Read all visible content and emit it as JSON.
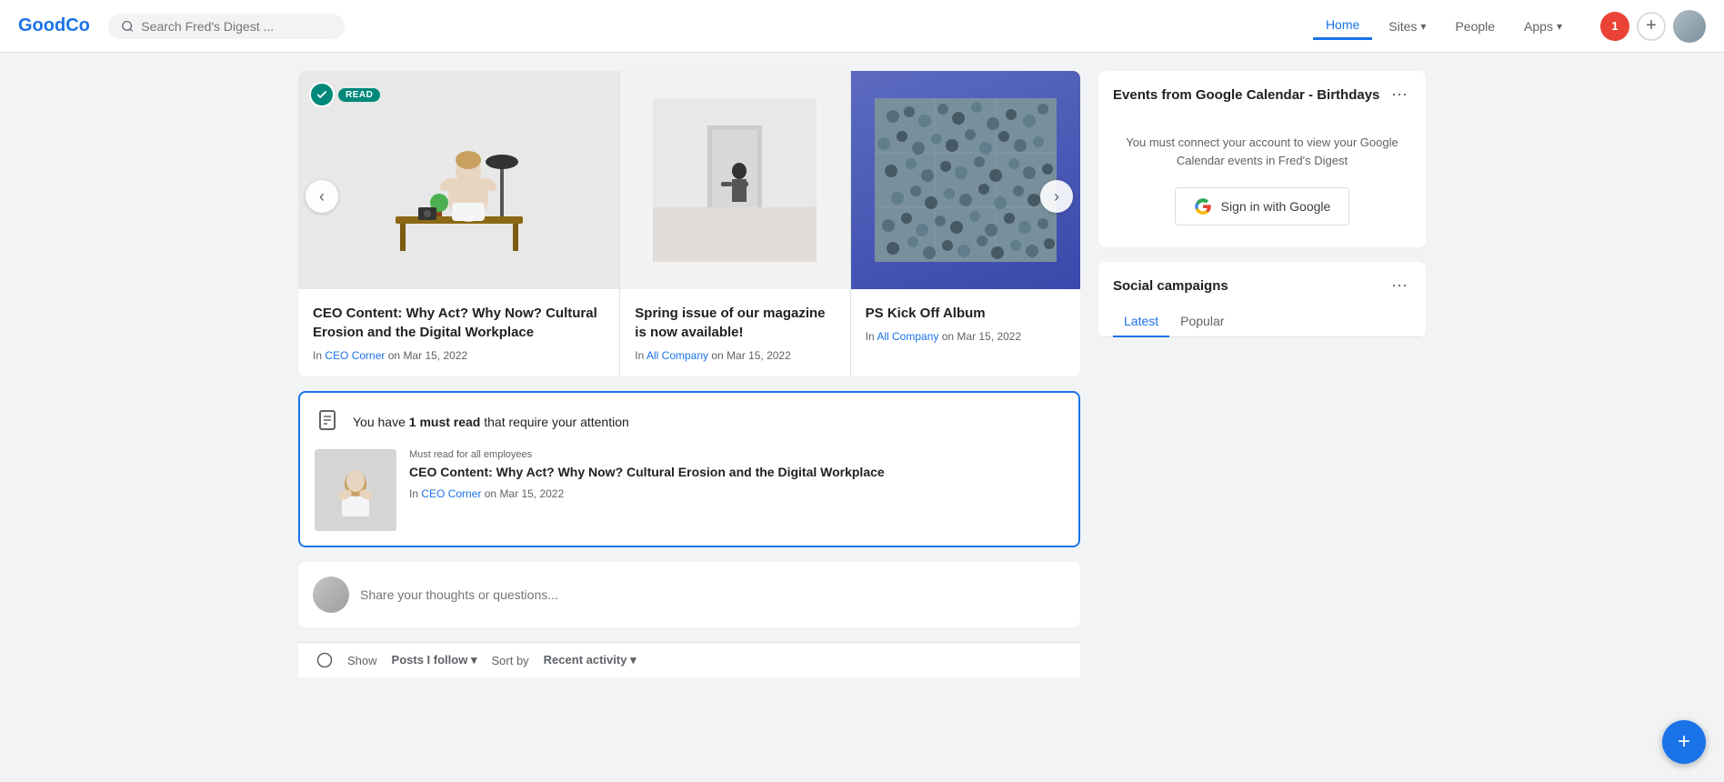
{
  "app": {
    "logo": "GoodCo"
  },
  "header": {
    "search_placeholder": "Search Fred's Digest ...",
    "nav": [
      {
        "id": "home",
        "label": "Home",
        "active": true
      },
      {
        "id": "sites",
        "label": "Sites",
        "dropdown": true
      },
      {
        "id": "people",
        "label": "People"
      },
      {
        "id": "apps",
        "label": "Apps",
        "dropdown": true
      }
    ],
    "notif_count": "1"
  },
  "carousel": {
    "prev_label": "‹",
    "next_label": "›",
    "read_badge": "READ",
    "slides": [
      {
        "id": "slide-1",
        "title": "CEO Content: Why Act? Why Now? Cultural Erosion and the Digital Workplace",
        "location": "CEO Corner",
        "date": "Mar 15, 2022",
        "preposition": "In",
        "conjunction": "on"
      },
      {
        "id": "slide-2",
        "title": "Spring issue of our magazine is now available!",
        "location": "All Company",
        "date": "Mar 15, 2022",
        "preposition": "In",
        "conjunction": "on"
      },
      {
        "id": "slide-3",
        "title": "PS Kick Off Album",
        "location": "All Company",
        "date": "Mar 15, 2022",
        "preposition": "In",
        "conjunction": "on"
      }
    ]
  },
  "must_read": {
    "prefix": "You have ",
    "count_text": "1 must read",
    "suffix": " that require your attention",
    "article": {
      "tag": "Must read for all employees",
      "title": "CEO Content: Why Act? Why Now? Cultural Erosion and the Digital Workplace",
      "location": "CEO Corner",
      "date": "Mar 15, 2022",
      "preposition": "In",
      "conjunction": "on"
    }
  },
  "thought_box": {
    "placeholder": "Share your thoughts or questions..."
  },
  "calendar_widget": {
    "title": "Events from Google Calendar - Birthdays",
    "body_text": "You must connect your account to view your Google Calendar events in Fred's Digest",
    "signin_label": "Sign in with Google"
  },
  "social_campaigns": {
    "title": "Social campaigns",
    "tabs": [
      {
        "id": "latest",
        "label": "Latest",
        "active": true
      },
      {
        "id": "popular",
        "label": "Popular"
      }
    ]
  },
  "bottom_bar": {
    "show_label": "Show",
    "posts_label": "Posts I follow",
    "sort_label": "Sort by",
    "sort_value": "Recent activity"
  },
  "fab": {
    "label": "+"
  },
  "icons": {
    "search": "🔍",
    "chevron_down": "▾",
    "more": "⋯",
    "doc": "📋",
    "google_colors": [
      "#4285F4",
      "#EA4335",
      "#FBBC05",
      "#34A853"
    ]
  }
}
